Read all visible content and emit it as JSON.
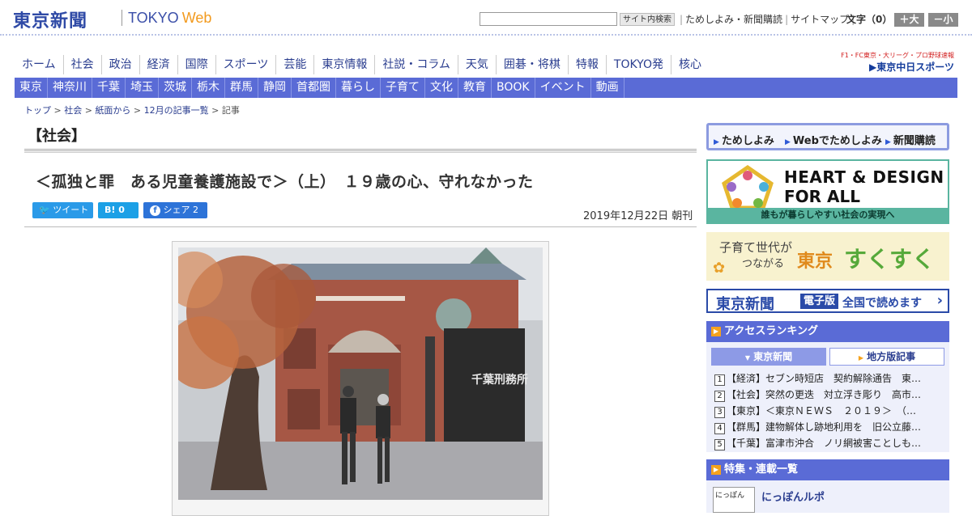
{
  "header": {
    "logo_ja": "東京新聞",
    "logo_en": "TOKYO",
    "logo_web": "Web",
    "search_placeholder": "",
    "search_button": "サイト内検索",
    "links": [
      "ためしよみ・新聞購読",
      "サイトマップ"
    ],
    "font_size_label": "文字（0）",
    "font_bigger": "＋大",
    "font_smaller": "－小"
  },
  "nav_main": [
    "ホーム",
    "社会",
    "政治",
    "経済",
    "国際",
    "スポーツ",
    "芸能",
    "東京情報",
    "社説・コラム",
    "天気",
    "囲碁・将棋",
    "特報",
    "TOKYO発",
    "核心"
  ],
  "chunichi": {
    "sub": "F1・FC東京・大リーグ・プロ野球速報",
    "name": "▶東京中日スポーツ"
  },
  "nav_region": [
    "東京",
    "神奈川",
    "千葉",
    "埼玉",
    "茨城",
    "栃木",
    "群馬",
    "静岡",
    "首都圏",
    "暮らし",
    "子育て",
    "文化",
    "教育",
    "BOOK",
    "イベント",
    "動画"
  ],
  "breadcrumb": [
    "トップ",
    "社会",
    "紙面から",
    "12月の記事一覧",
    "記事"
  ],
  "article": {
    "section": "【社会】",
    "title": "＜孤独と罪　ある児童養護施設で＞（上）　１９歳の心、守れなかった",
    "share_tweet": "ツイート",
    "share_hatena": "B! 0",
    "share_fb": "シェア 2",
    "date": "2019年12月22日 朝刊",
    "photo_sign": "千葉刑務所"
  },
  "sidebar": {
    "top_links": [
      "ためしよみ",
      "Webでためしよみ",
      "新聞購読"
    ],
    "heart_design_line1": "HEART & DESIGN",
    "heart_design_line2": "FOR ALL",
    "heart_design_strip": "誰もが暮らしやすい社会の実現へ",
    "sukusuku_line1": "子育て世代が",
    "sukusuku_line2": "つながる",
    "sukusuku_tokyo": "東京",
    "sukusuku_brand": "すくすく",
    "epaper_name": "東京新聞",
    "epaper_badge": "電子版",
    "epaper_text": "全国で読めます",
    "ranking_title": "アクセスランキング",
    "ranking_tabs": [
      "東京新聞",
      "地方版記事"
    ],
    "ranking": [
      {
        "n": "1",
        "text": "【経済】セブン時短店　契約解除通告　東…"
      },
      {
        "n": "2",
        "text": "【社会】突然の更迭　対立浮き彫り　高市…"
      },
      {
        "n": "3",
        "text": "【東京】＜東京ＮＥＷＳ　２０１９＞　（…"
      },
      {
        "n": "4",
        "text": "【群馬】建物解体し跡地利用を　旧公立藤…"
      },
      {
        "n": "5",
        "text": "【千葉】富津市沖合　ノリ網被害ことしも…"
      }
    ],
    "features_title": "特集・連載一覧",
    "features_item": "にっぽんルポ",
    "features_thumb": "にっぽん"
  }
}
